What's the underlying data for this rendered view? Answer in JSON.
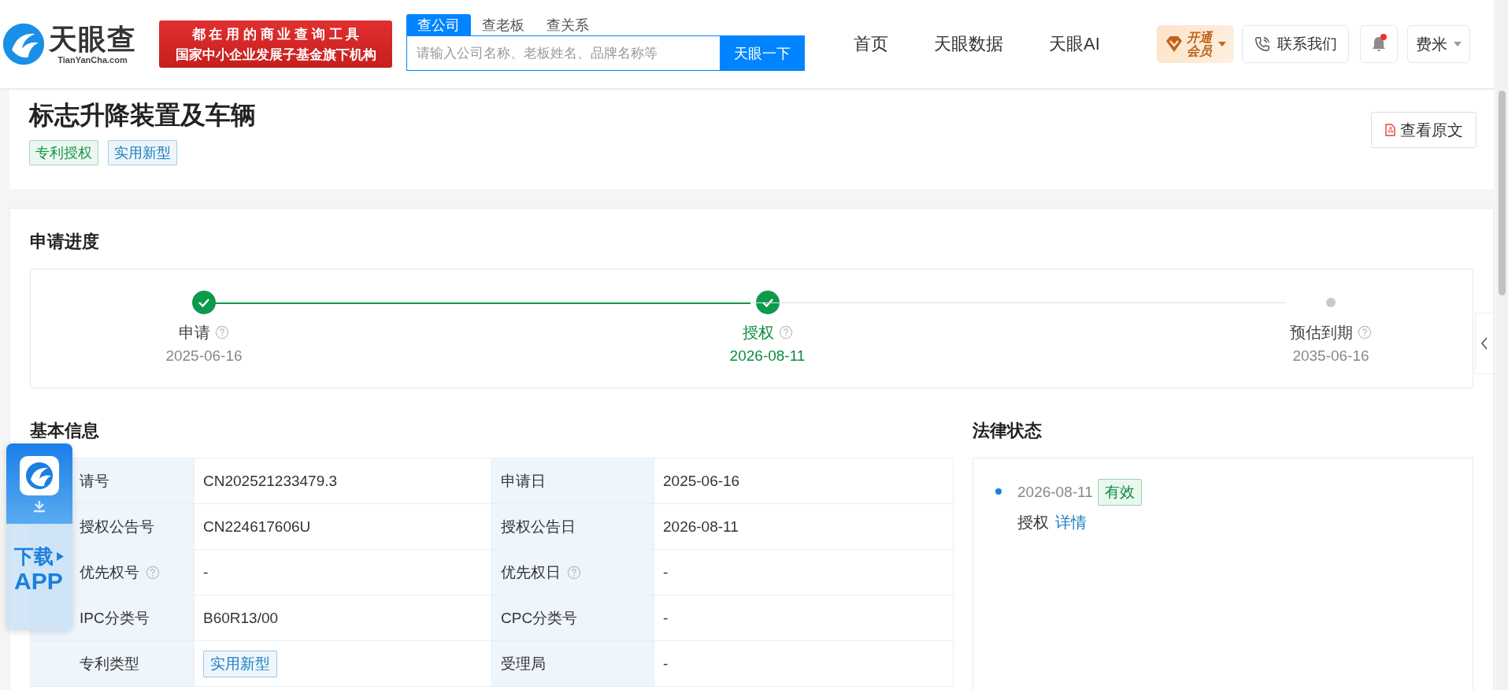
{
  "header": {
    "logo": {
      "name": "天眼查",
      "domain": "TianYanCha.com"
    },
    "banner": {
      "line1": "都 在 用 的 商 业 查 询 工 具",
      "line2": "国家中小企业发展子基金旗下机构"
    },
    "search_tabs": [
      {
        "label": "查公司",
        "selected": true
      },
      {
        "label": "查老板",
        "selected": false
      },
      {
        "label": "查关系",
        "selected": false
      }
    ],
    "search": {
      "placeholder": "请输入公司名称、老板姓名、品牌名称等",
      "button": "天眼一下"
    },
    "nav": [
      "首页",
      "天眼数据",
      "天眼AI"
    ],
    "vip": {
      "line1": "开通",
      "line2": "会员"
    },
    "contact": "联系我们",
    "notification_unread": true,
    "user": "费米"
  },
  "patent": {
    "title": "标志升降装置及车辆",
    "tags": [
      {
        "label": "专利授权",
        "color": "#1a9a4a"
      },
      {
        "label": "实用新型",
        "color": "#1a7fc1"
      }
    ],
    "view_original": "查看原文"
  },
  "progress": {
    "heading": "申请进度",
    "steps": [
      {
        "label": "申请",
        "date": "2025-06-16",
        "done": true,
        "current": false
      },
      {
        "label": "授权",
        "date": "2026-08-11",
        "done": true,
        "current": true
      },
      {
        "label": "预估到期",
        "date": "2035-06-16",
        "done": false,
        "current": false
      }
    ]
  },
  "basic_info": {
    "heading": "基本信息",
    "rows": [
      {
        "label": "请号",
        "help": false,
        "value": "CN202521233479.3",
        "kind": "text",
        "label2": "申请日",
        "help2": false,
        "value2": "2025-06-16"
      },
      {
        "label": "授权公告号",
        "help": false,
        "value": "CN224617606U",
        "kind": "text",
        "label2": "授权公告日",
        "help2": false,
        "value2": "2026-08-11"
      },
      {
        "label": "优先权号",
        "help": true,
        "value": "-",
        "kind": "text",
        "label2": "优先权日",
        "help2": true,
        "value2": "-"
      },
      {
        "label": "IPC分类号",
        "help": false,
        "value": "B60R13/00",
        "kind": "text",
        "label2": "CPC分类号",
        "help2": false,
        "value2": "-"
      },
      {
        "label": "专利类型",
        "help": false,
        "value": "实用新型",
        "kind": "tag",
        "label2": "受理局",
        "help2": false,
        "value2": "-"
      }
    ]
  },
  "legal_status": {
    "heading": "法律状态",
    "events": [
      {
        "date": "2026-08-11",
        "status": "有效",
        "event": "授权",
        "link": "详情"
      }
    ]
  },
  "download_app": {
    "line1": "下载",
    "line2": "APP"
  }
}
